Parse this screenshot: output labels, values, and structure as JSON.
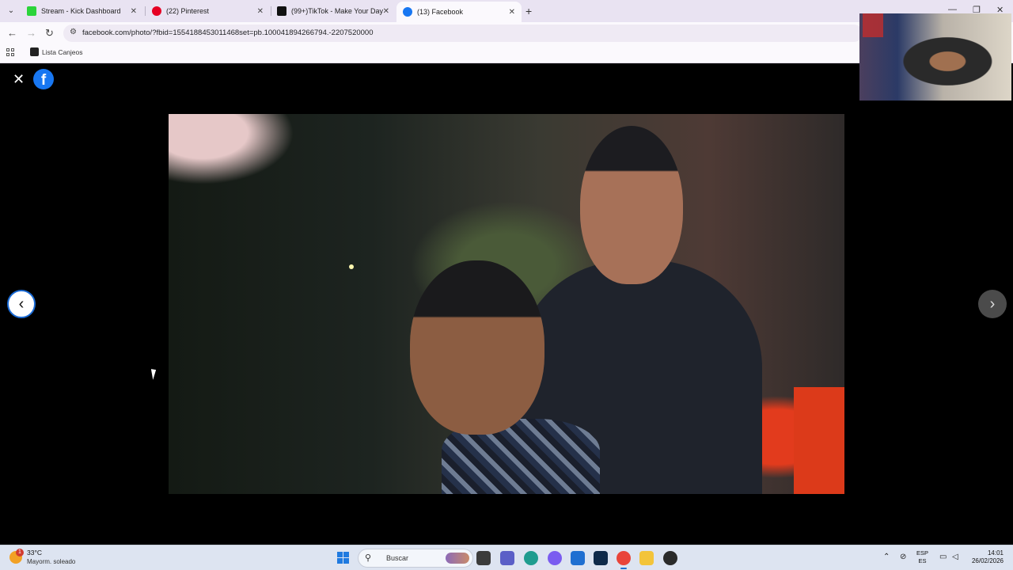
{
  "browser": {
    "tabs": [
      {
        "title": "Stream - Kick Dashboard",
        "favicon_color": "#2bd43a"
      },
      {
        "title": "(22) Pinterest",
        "favicon_color": "#e60023"
      },
      {
        "title": "(99+)TikTok - Make Your Day",
        "favicon_color": "#111111"
      },
      {
        "title": "(13) Facebook",
        "favicon_color": "#1877f2"
      }
    ],
    "active_tab_index": 3,
    "url": "facebook.com/photo/?fbid=1554188453011468set=pb.100041894266794.-2207520000",
    "bookmarks": [
      {
        "label": "Lista Canjeos"
      }
    ]
  },
  "viewer": {
    "logo_letter": "f",
    "close_glyph": "✕",
    "prev_glyph": "‹",
    "next_glyph": "›"
  },
  "taskbar": {
    "weather": {
      "temp": "33°C",
      "desc": "Mayorm. soleado",
      "badge": "1"
    },
    "search_placeholder": "Buscar",
    "language": {
      "line1": "ESP",
      "line2": "ES"
    },
    "clock": {
      "time": "14:01",
      "date": "26/02/2026"
    },
    "apps": [
      {
        "name": "file-manager",
        "color": "#3b3b3b"
      },
      {
        "name": "teams",
        "color": "#5b5fc7"
      },
      {
        "name": "edge",
        "color": "#1f9c8f"
      },
      {
        "name": "copilot",
        "color": "#7a5cf0"
      },
      {
        "name": "store",
        "color": "#1f6fd1"
      },
      {
        "name": "photoshop",
        "color": "#0f2a4a"
      },
      {
        "name": "chrome",
        "color": "#e9443a"
      },
      {
        "name": "explorer",
        "color": "#f3c43a"
      },
      {
        "name": "obs",
        "color": "#2a2a2a"
      }
    ]
  }
}
